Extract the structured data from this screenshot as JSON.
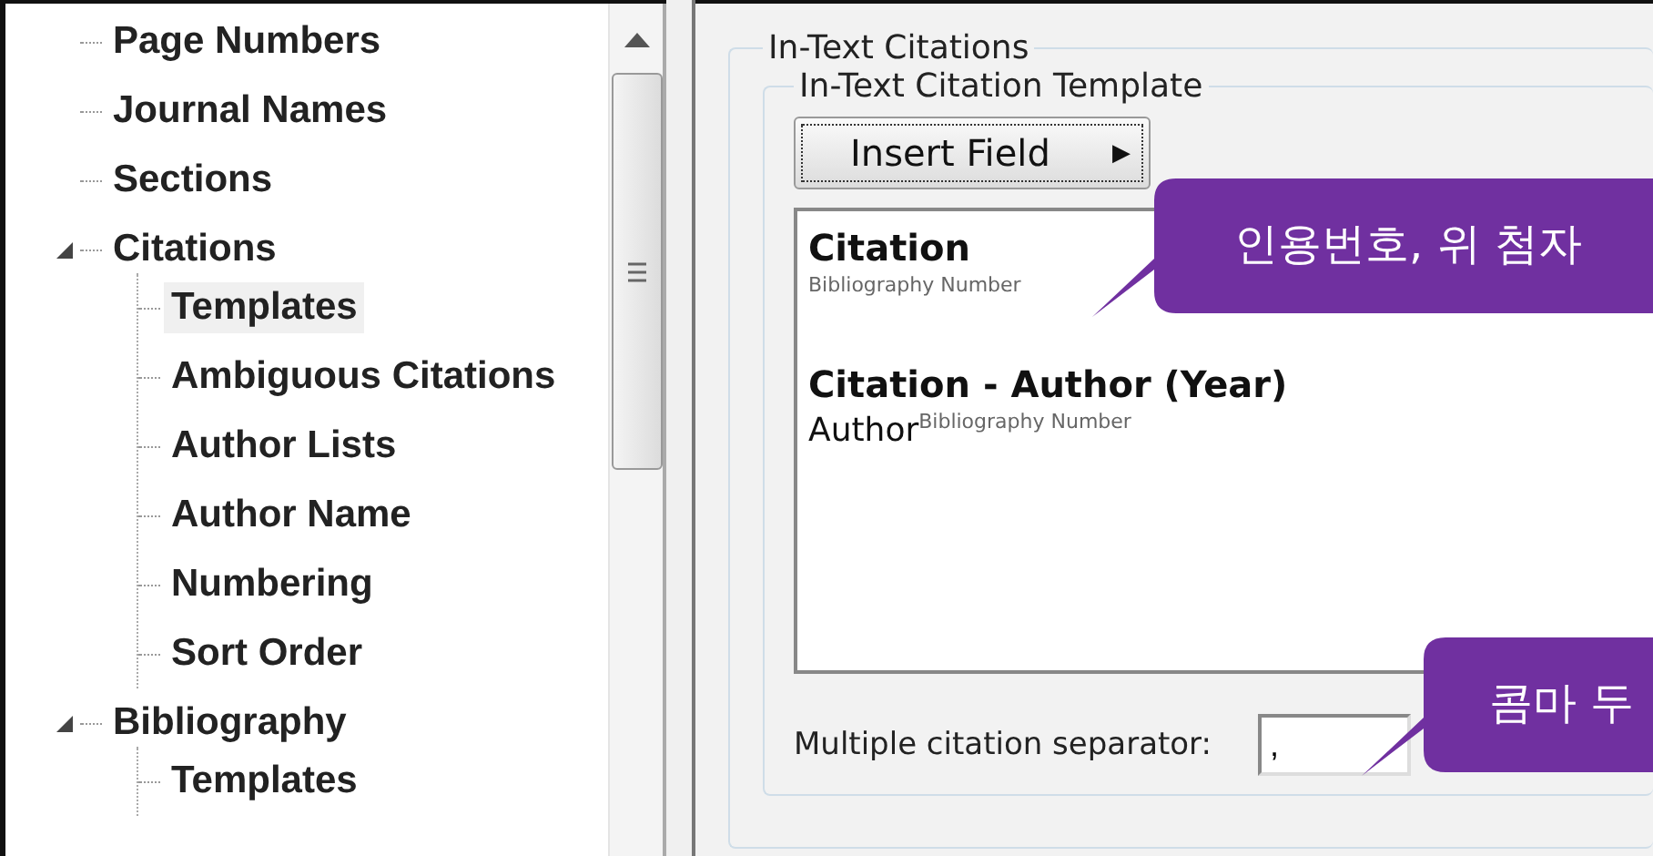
{
  "tree": [
    {
      "label": "Page Numbers",
      "selected": false
    },
    {
      "label": "Journal Names",
      "selected": false
    },
    {
      "label": "Sections",
      "selected": false
    },
    {
      "label": "Citations",
      "selected": false,
      "expanded": true,
      "children": [
        {
          "label": "Templates",
          "selected": true
        },
        {
          "label": "Ambiguous Citations",
          "selected": false
        },
        {
          "label": "Author Lists",
          "selected": false
        },
        {
          "label": "Author Name",
          "selected": false
        },
        {
          "label": "Numbering",
          "selected": false
        },
        {
          "label": "Sort Order",
          "selected": false
        }
      ]
    },
    {
      "label": "Bibliography",
      "selected": false,
      "expanded": true,
      "children": [
        {
          "label": "Templates",
          "selected": false
        }
      ]
    }
  ],
  "group": {
    "title": "In-Text Citations",
    "template_group": {
      "title": "In-Text Citation Template",
      "insert_button": {
        "label": "Insert Field",
        "arrow": "▶"
      },
      "templates": [
        {
          "heading": "Citation",
          "superscript": "Bibliography Number"
        },
        {
          "heading": "Citation - Author (Year)",
          "text": "Author",
          "superscript": "Bibliography Number"
        }
      ]
    },
    "separator": {
      "label": "Multiple citation separator:",
      "value": ","
    }
  },
  "callouts": [
    {
      "text": "인용번호, 위 첨자"
    },
    {
      "text": "콤마 두"
    }
  ]
}
